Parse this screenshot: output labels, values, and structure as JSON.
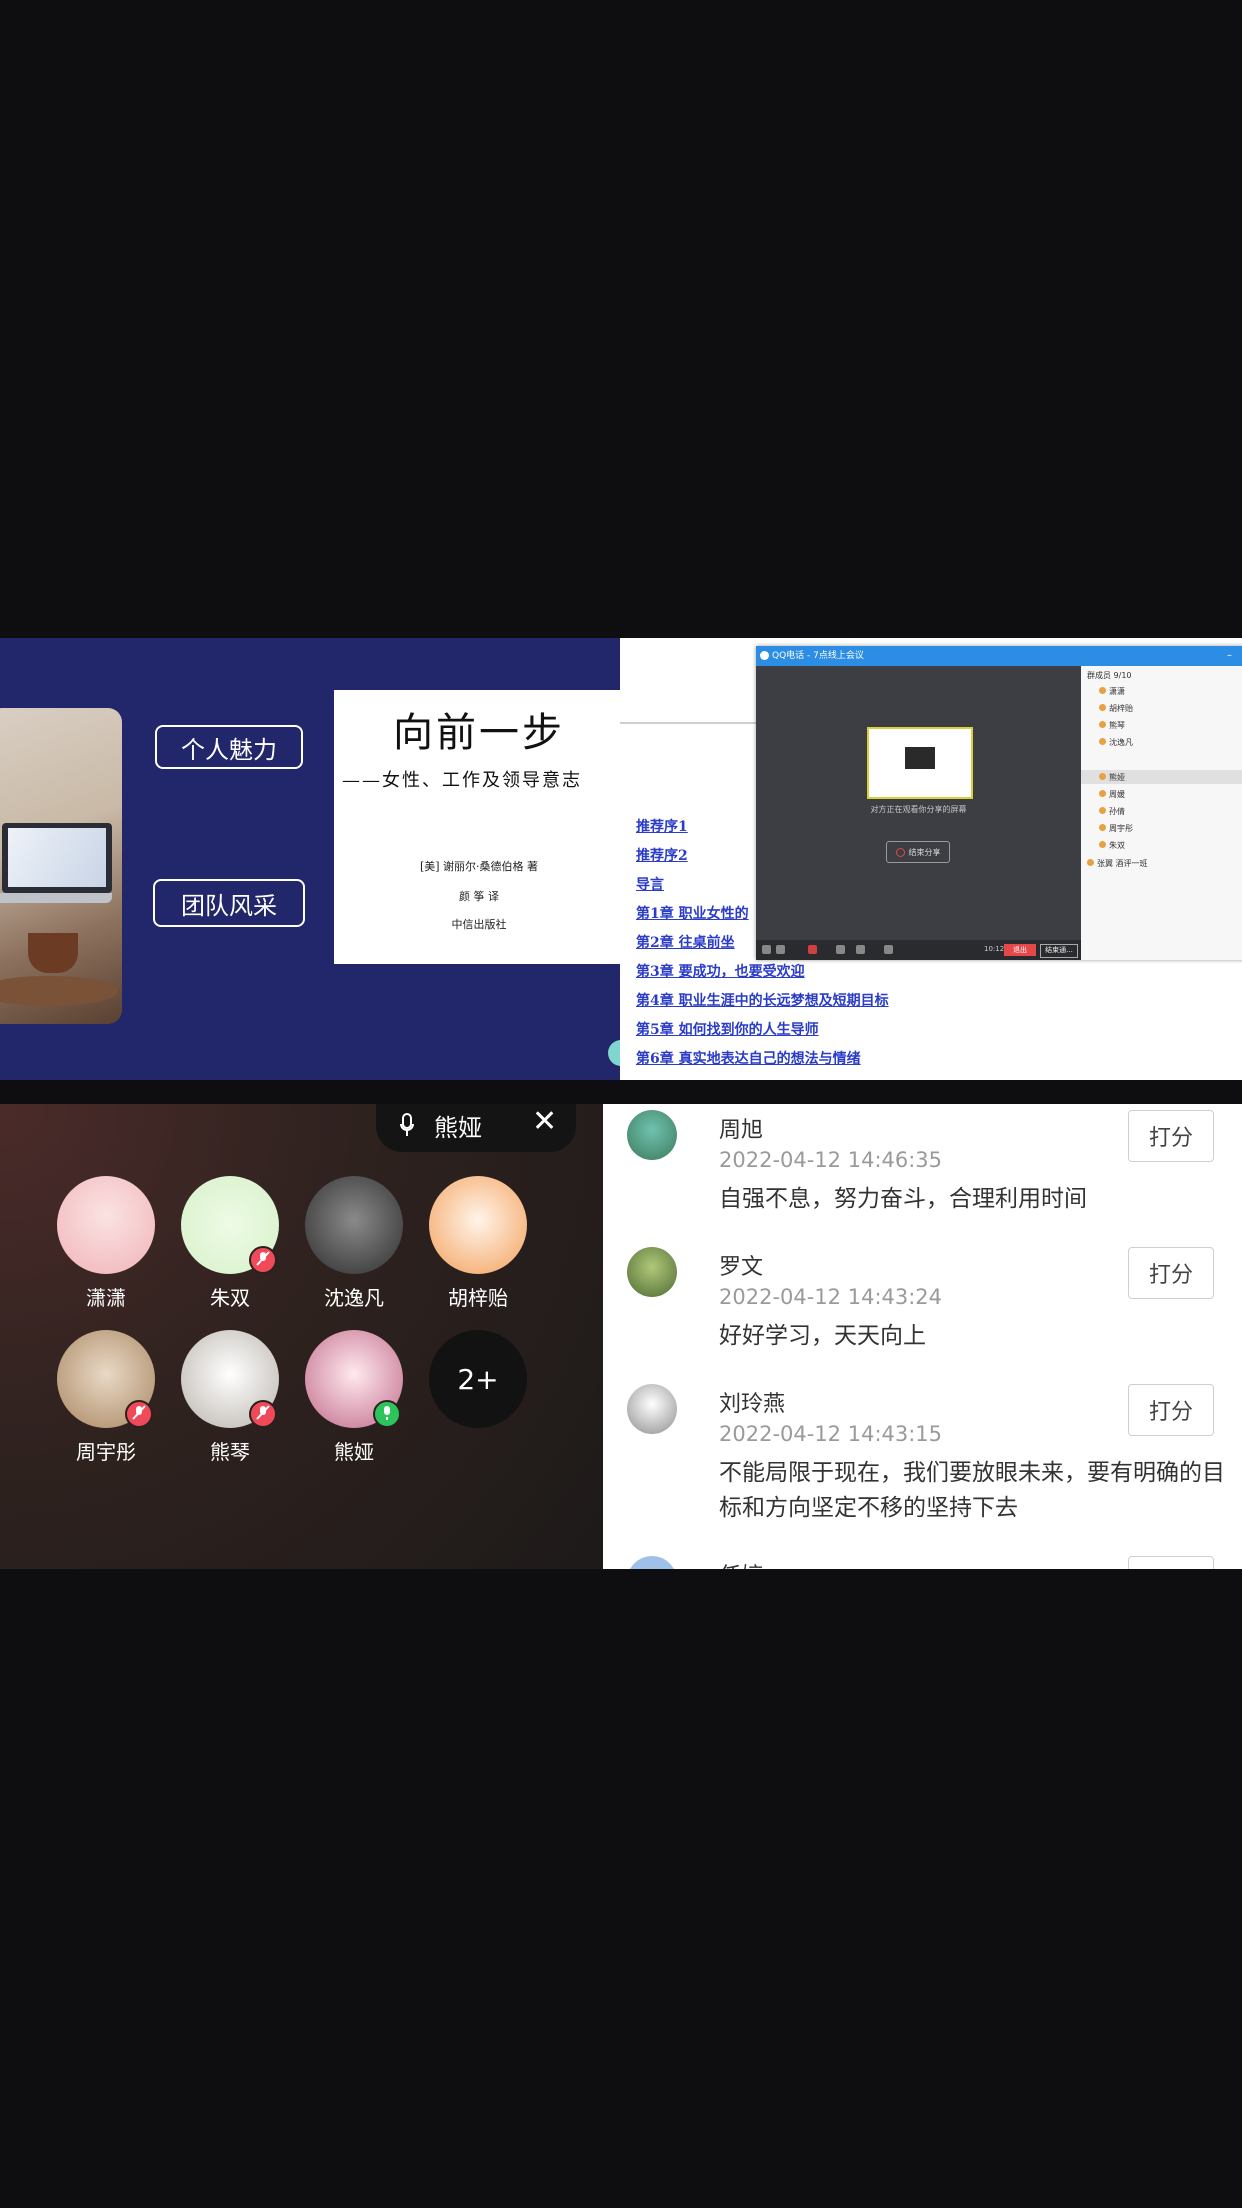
{
  "slide": {
    "button_charm": "个人魅力",
    "button_team": "团队风采",
    "book": {
      "title": "向前一步",
      "subtitle": "——女性、工作及领导意志",
      "author": "[美] 谢丽尔·桑德伯格 著",
      "translator": "颜 筝 译",
      "publisher": "中信出版社"
    }
  },
  "document": {
    "toc": [
      "推荐序1",
      "推荐序2",
      "导言",
      "第1章 职业女性的",
      "第2章 往桌前坐",
      "第3章 要成功，也要受欢迎",
      "第4章 职业生涯中的长远梦想及短期目标",
      "第5章 如何找到你的人生导师",
      "第6章 真实地表达自己的想法与情绪"
    ],
    "qq_window": {
      "title": "QQ电话 - 7点线上会议",
      "share_caption": "对方正在观看你分享的屏幕",
      "stop_share": "结束分享",
      "exit": "退出",
      "end": "结束通...",
      "time": "10:12",
      "member_header": "群成员 9/10",
      "members": [
        "潇潇",
        "胡梓贻",
        "熊琴",
        "沈逸凡",
        "熊娅",
        "周媛",
        "孙倩",
        "周宇彤",
        "朱双",
        "张翼 酒评一班"
      ]
    }
  },
  "room": {
    "current_speaker": "熊娅",
    "members": [
      {
        "name": "潇潇",
        "status": "none"
      },
      {
        "name": "朱双",
        "status": "muted"
      },
      {
        "name": "沈逸凡",
        "status": "none"
      },
      {
        "name": "胡梓贻",
        "status": "none"
      },
      {
        "name": "周宇彤",
        "status": "muted"
      },
      {
        "name": "熊琴",
        "status": "muted"
      },
      {
        "name": "熊娅",
        "status": "speaking"
      }
    ],
    "more_label": "2+"
  },
  "comments": {
    "items": [
      {
        "name": "周旭",
        "time": "2022-04-12 14:46:35",
        "text": "自强不息，努力奋斗，合理利用时间",
        "button": "打分"
      },
      {
        "name": "罗文",
        "time": "2022-04-12 14:43:24",
        "text": "好好学习，天天向上",
        "button": "打分"
      },
      {
        "name": "刘玲燕",
        "time": "2022-04-12 14:43:15",
        "text": "不能局限于现在，我们要放眼未来，要有明确的目标和方向坚定不移的坚持下去",
        "button": "打分"
      }
    ],
    "partial_name": "任婷"
  },
  "colors": {
    "slide_bg": "#22266a",
    "link_blue": "#2a3cc8",
    "qq_blue": "#2b8de4",
    "muted_red": "#f04a5a",
    "speaking_green": "#2ec45c"
  }
}
